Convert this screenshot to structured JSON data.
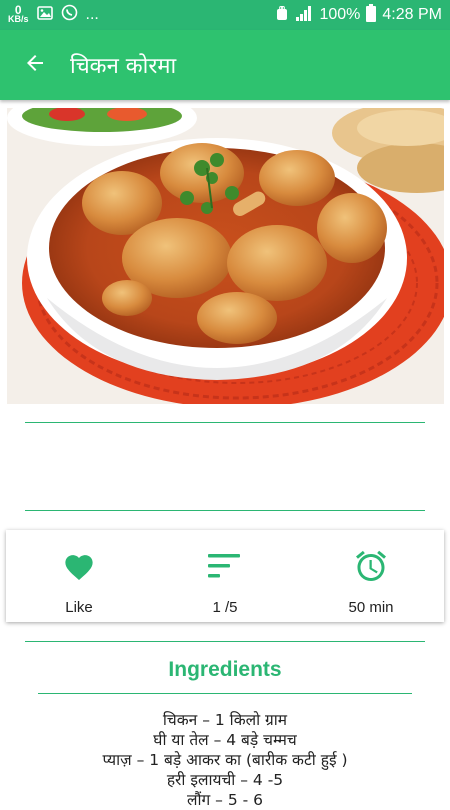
{
  "status_bar": {
    "net_speed_value": "0",
    "net_speed_unit": "KB/s",
    "overflow_dots": "...",
    "battery_percent": "100%",
    "time": "4:28 PM"
  },
  "app_bar": {
    "title": "चिकन कोरमा"
  },
  "stats": {
    "like_label": "Like",
    "servings_label": "1 /5",
    "time_label": "50 min"
  },
  "ingredients": {
    "heading": "Ingredients",
    "items": [
      "चिकन – 1 किलो ग्राम",
      "घी या तेल – 4 बड़े चम्मच",
      "प्याज़ – 1 बड़े आकर का (बारीक कटी हुई )",
      "हरी इलायची – 4 -5",
      "लौंग – 5 - 6"
    ]
  },
  "colors": {
    "primary": "#2ec26f",
    "primary_dark": "#2bb673",
    "accent_text": "#2bb673"
  }
}
